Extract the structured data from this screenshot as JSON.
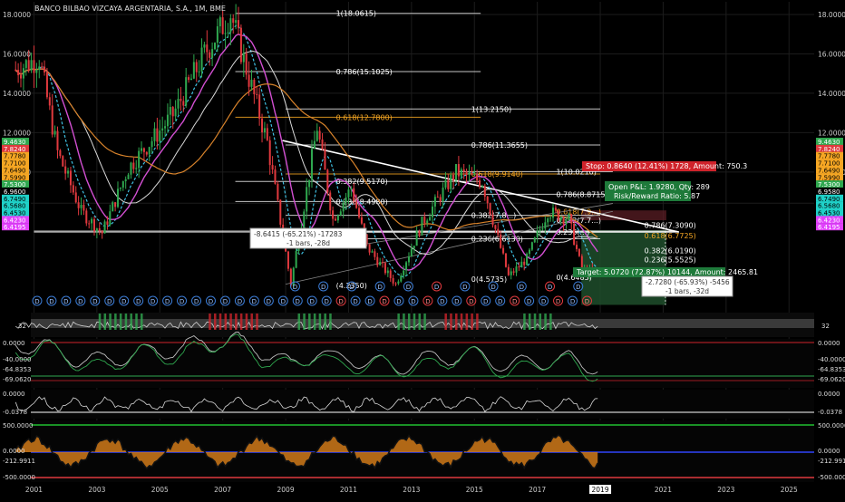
{
  "chart_title": "BANCO BILBAO VIZCAYA ARGENTARIA, S.A., 1M, BME",
  "colors": {
    "background": "#000000",
    "grid": "#1c1c1c",
    "candle_up": "#2fa84f",
    "candle_down": "#e0393e",
    "ema_fast": "#3fbfe0",
    "ema_mid": "#d24fd2",
    "ema_slow": "#d9d9d9",
    "ema_long": "#d8832b",
    "fib": "#e8e8e8",
    "fib_highlight": "#f5a623",
    "trend": "#ffffff",
    "target_zone": "#1e4d2b",
    "stop_zone": "#5a1e24",
    "event_circle": "#3a7bd5",
    "event_circle_red": "#e0393e"
  },
  "x_axis": {
    "ticks": [
      "2001",
      "2003",
      "2005",
      "2007",
      "2009",
      "2011",
      "2013",
      "2015",
      "2017",
      "2019",
      "2021",
      "2023",
      "2025"
    ],
    "highlight": "2019"
  },
  "left_axis": {
    "ticks": [
      "18.0000",
      "16.0000",
      "14.0000",
      "12.0000",
      "10.0000",
      "8.4165"
    ],
    "badges": [
      {
        "text": "9.4630",
        "color": "#2fa84f"
      },
      {
        "text": "7.8240",
        "color": "#e0393e"
      },
      {
        "text": "7.7780",
        "color": "#f5a623"
      },
      {
        "text": "7.7100",
        "color": "#f5a623"
      },
      {
        "text": "7.6490",
        "color": "#f5a623"
      },
      {
        "text": "7.5990",
        "color": "#f5a623"
      },
      {
        "text": "7.5300",
        "color": "#2fa84f"
      },
      {
        "text": "6.9600",
        "color": "#000000"
      },
      {
        "text": "6.7490",
        "color": "#1fd1c8"
      },
      {
        "text": "6.5680",
        "color": "#1fd1c8"
      },
      {
        "text": "6.4530",
        "color": "#1fd1c8"
      },
      {
        "text": "6.4230",
        "color": "#e040fb"
      },
      {
        "text": "6.4195",
        "color": "#e040fb"
      }
    ]
  },
  "right_axis": {
    "ticks": [
      "18.0000",
      "16.0000",
      "14.0000",
      "12.0000",
      "10.0000",
      "8.4165"
    ],
    "badges": [
      {
        "text": "9.4630",
        "color": "#2fa84f"
      },
      {
        "text": "7.8240",
        "color": "#e0393e"
      },
      {
        "text": "7.7780",
        "color": "#f5a623"
      },
      {
        "text": "7.7100",
        "color": "#f5a623"
      },
      {
        "text": "7.6490",
        "color": "#f5a623"
      },
      {
        "text": "7.5990",
        "color": "#f5a623"
      },
      {
        "text": "7.5300",
        "color": "#2fa84f"
      },
      {
        "text": "6.9580",
        "color": "#000000"
      },
      {
        "text": "6.7490",
        "color": "#1fd1c8"
      },
      {
        "text": "6.5680",
        "color": "#1fd1c8"
      },
      {
        "text": "6.4530",
        "color": "#1fd1c8"
      },
      {
        "text": "6.4230",
        "color": "#e040fb"
      },
      {
        "text": "6.4195",
        "color": "#e040fb"
      }
    ]
  },
  "fib_labels": [
    {
      "text": "1(18.0615)",
      "price": 18.06,
      "year": 2010.6
    },
    {
      "text": "0.786(15.1025)",
      "price": 15.1,
      "year": 2010.6
    },
    {
      "text": "0.618(12.7800)",
      "price": 12.78,
      "year": 2010.6,
      "highlight": true
    },
    {
      "text": "1(13.2150)",
      "price": 13.2,
      "year": 2014.9
    },
    {
      "text": "0.786(11.3655)",
      "price": 11.37,
      "year": 2014.9
    },
    {
      "text": "0.618(9.9140)",
      "price": 9.9,
      "year": 2014.9,
      "highlight": true
    },
    {
      "text": "1(10.0210)",
      "price": 10.02,
      "year": 2017.6
    },
    {
      "text": "0.786(8.8715)",
      "price": 8.87,
      "year": 2017.6
    },
    {
      "text": "0.618(7.9...)",
      "price": 8.0,
      "year": 2017.6,
      "highlight": true
    },
    {
      "text": "0.382(7.7...)",
      "price": 7.55,
      "year": 2017.6
    },
    {
      "text": "0.236(...)",
      "price": 6.95,
      "year": 2017.6
    },
    {
      "text": "0(4.6485)",
      "price": 4.65,
      "year": 2017.6
    },
    {
      "text": "0.382(9.5170)",
      "price": 9.52,
      "year": 2010.6
    },
    {
      "text": "0.236(8.4980)",
      "price": 8.5,
      "year": 2010.6
    },
    {
      "text": "0.382(7.8...)",
      "price": 7.8,
      "year": 2014.9
    },
    {
      "text": "0.236(6.6130)",
      "price": 6.61,
      "year": 2014.9
    },
    {
      "text": "0(4.5735)",
      "price": 4.57,
      "year": 2014.9
    },
    {
      "text": "(4.2350)",
      "price": 4.23,
      "year": 2010.6
    },
    {
      "text": "0.786(7.3090)",
      "price": 7.31,
      "year": 2020.4
    },
    {
      "text": "0.618(6.7725)",
      "price": 6.77,
      "year": 2020.4,
      "highlight": true
    },
    {
      "text": "0.382(6.0190)",
      "price": 6.02,
      "year": 2020.4
    },
    {
      "text": "0.236(5.5525)",
      "price": 5.55,
      "year": 2020.4
    },
    {
      "text": "0(4.7990)",
      "price": 4.8,
      "year": 2020.4
    }
  ],
  "position": {
    "stop_text": "Stop: 0.8640 (12.41%) 1728, Amount: 750.3",
    "open_text": "Open P&L: 1.9280, Qty: 289",
    "rr_text": "Risk/Reward Ratio: 5.87",
    "target_text": "Target: 5.0720 (72.87%) 10144, Amount: 2465.81"
  },
  "measures": [
    {
      "line1": "-8.6415 (-65.21%) -17283",
      "line2": "-1 bars, -28d"
    },
    {
      "line1": "-2.7280 (-65.93%) -5456",
      "line2": "-1 bars, -32d"
    }
  ],
  "event_row": {
    "letters_top": [
      "D",
      "D",
      "D",
      "D",
      "D",
      "D",
      "D",
      "D",
      "D",
      "D",
      "D"
    ],
    "letters_bottom": [
      "D",
      "D",
      "D",
      "D",
      "D",
      "D",
      "D",
      "D",
      "D",
      "D",
      "D",
      "D",
      "D",
      "D",
      "D",
      "D",
      "D",
      "D",
      "D",
      "D",
      "D",
      "D",
      "D",
      "D",
      "D",
      "D",
      "D",
      "D",
      "D",
      "D",
      "D",
      "D",
      "D",
      "D",
      "D",
      "D",
      "D",
      "D",
      "D"
    ],
    "red_letter": "E"
  },
  "panels": {
    "osc1": {
      "left_value": "32",
      "right_value": "32"
    },
    "williams": {
      "left_ticks": [
        "0.0000",
        "-40.0000",
        "-64.8353",
        "-69.0620"
      ],
      "right_ticks": [
        "0.0000",
        "-40.0000",
        "-64.8353",
        "-69.0620"
      ]
    },
    "ppo": {
      "left_ticks": [
        "0.0000",
        "-0.0378"
      ],
      "right_ticks": [
        "0.0000",
        "-0.0378"
      ]
    },
    "cci": {
      "left_ticks": [
        "500.0000",
        "0.0000",
        "-212.9911",
        "-500.0000"
      ],
      "right_ticks": [
        "500.0000",
        "0.0000",
        "-212.9911",
        "-500.0000"
      ]
    }
  },
  "chart_data": {
    "type": "candlestick",
    "title": "BANCO BILBAO VIZCAYA ARGENTARIA, S.A., 1M, BME",
    "interval": "1M",
    "x_range": [
      "2001",
      "2025"
    ],
    "y_range": [
      4.0,
      18.5
    ],
    "anchors": [
      {
        "date": "2000-06",
        "price": 15.2
      },
      {
        "date": "2001-03",
        "price": 15.8
      },
      {
        "date": "2001-10",
        "price": 11.0
      },
      {
        "date": "2002-07",
        "price": 8.0
      },
      {
        "date": "2003-03",
        "price": 6.9
      },
      {
        "date": "2004-01",
        "price": 10.2
      },
      {
        "date": "2005-06",
        "price": 12.9
      },
      {
        "date": "2006-06",
        "price": 16.0
      },
      {
        "date": "2007-04",
        "price": 18.06
      },
      {
        "date": "2008-06",
        "price": 11.5
      },
      {
        "date": "2009-03",
        "price": 4.3
      },
      {
        "date": "2010-01",
        "price": 12.3
      },
      {
        "date": "2010-07",
        "price": 7.6
      },
      {
        "date": "2011-02",
        "price": 9.2
      },
      {
        "date": "2011-08",
        "price": 6.2
      },
      {
        "date": "2012-07",
        "price": 4.3
      },
      {
        "date": "2013-05",
        "price": 7.4
      },
      {
        "date": "2014-06",
        "price": 10.0
      },
      {
        "date": "2015-04",
        "price": 9.5
      },
      {
        "date": "2016-02",
        "price": 4.7
      },
      {
        "date": "2016-09",
        "price": 5.6
      },
      {
        "date": "2017-05",
        "price": 8.0
      },
      {
        "date": "2018-01",
        "price": 7.6
      },
      {
        "date": "2018-06",
        "price": 5.0
      },
      {
        "date": "2018-12",
        "price": 4.9
      }
    ],
    "last_price": 5.0
  }
}
